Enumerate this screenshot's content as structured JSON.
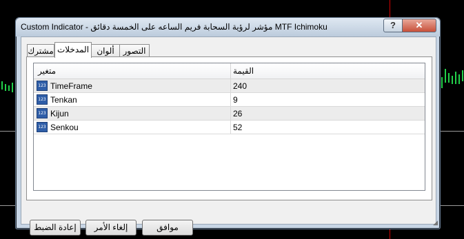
{
  "window": {
    "title": "Custom Indicator - مؤشر لرؤية السحابة فريم الساعه على الخمسة دقائق MTF Ichimoku",
    "help_label": "?",
    "close_label": "✕"
  },
  "tabs": [
    {
      "label": "مشترك"
    },
    {
      "label": "المدخلات"
    },
    {
      "label": "ألوان"
    },
    {
      "label": "التصور"
    }
  ],
  "grid": {
    "headers": {
      "variable": "متغير",
      "value": "القيمة"
    },
    "rows": [
      {
        "icon_text": "123",
        "name": "TimeFrame",
        "value": "240"
      },
      {
        "icon_text": "123",
        "name": "Tenkan",
        "value": "9"
      },
      {
        "icon_text": "123",
        "name": "Kijun",
        "value": "26"
      },
      {
        "icon_text": "123",
        "name": "Senkou",
        "value": "52"
      }
    ]
  },
  "buttons": {
    "reset": "إعادة الضبط",
    "cancel": "إلغاء الأمر",
    "ok": "موافق"
  },
  "colors": {
    "chart_background": "#000000",
    "candle": "#22d04a",
    "vline": "#d40000"
  }
}
